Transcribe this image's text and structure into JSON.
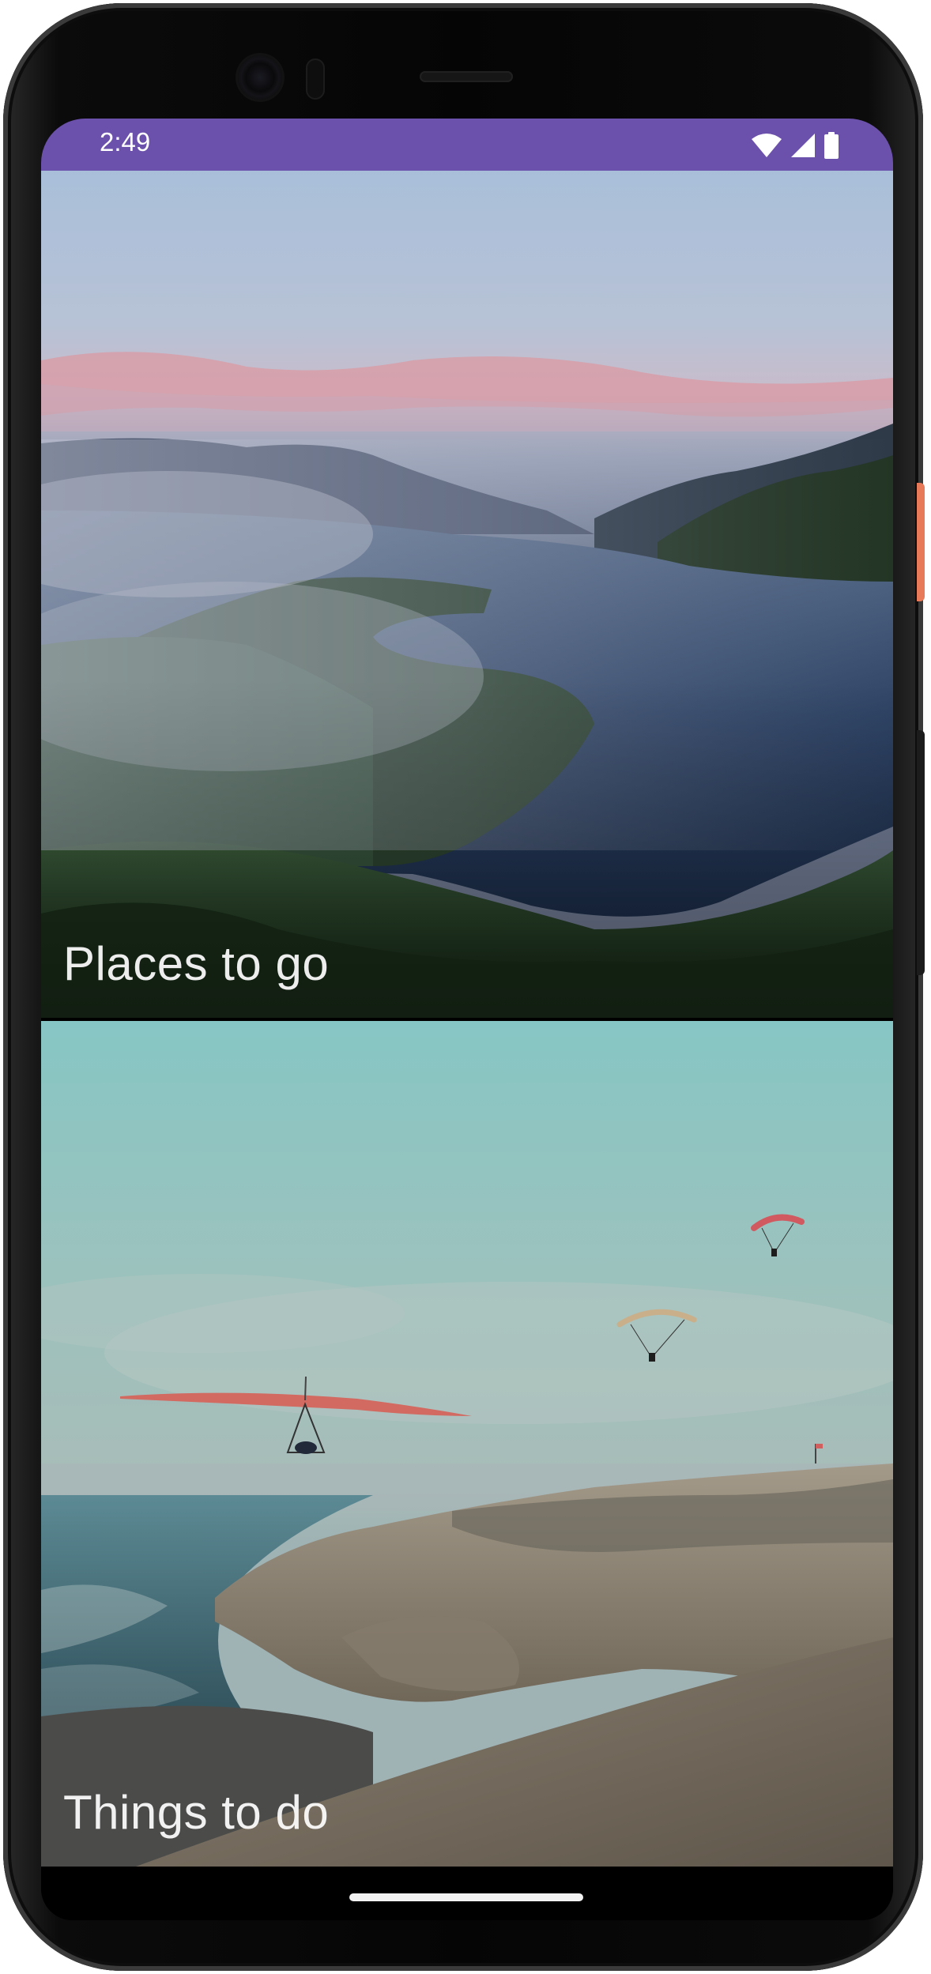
{
  "status_bar": {
    "time": "2:49",
    "background_color": "#6b51ab",
    "icons": [
      "wifi-icon",
      "cellular-signal-icon",
      "battery-icon"
    ]
  },
  "cards": [
    {
      "label": "Places to go",
      "image": "crater-lake-landscape"
    },
    {
      "label": "Things to do",
      "image": "hang-gliding-coastal-cliffs"
    }
  ],
  "navigation": {
    "gesture_bar": "home-indicator"
  },
  "colors": {
    "device_frame": "#050505",
    "power_button": "#e87a5a"
  }
}
